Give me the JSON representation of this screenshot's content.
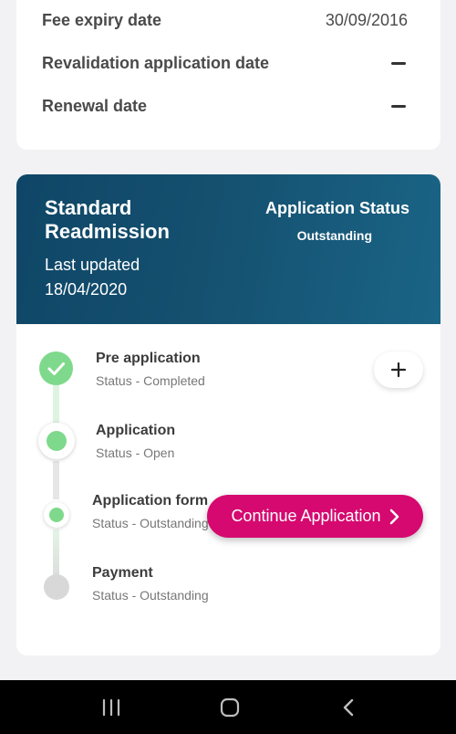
{
  "info": {
    "rows": [
      {
        "label": "Fee expiry date",
        "value": "30/09/2016"
      },
      {
        "label": "Revalidation application date",
        "value": "—"
      },
      {
        "label": "Renewal date",
        "value": "—"
      }
    ]
  },
  "readmission": {
    "title": "Standard Readmission",
    "last_updated_label": "Last updated",
    "last_updated_date": "18/04/2020",
    "status_label": "Application Status",
    "status_value": "Outstanding"
  },
  "steps": [
    {
      "title": "Pre application",
      "status": "Status - Completed"
    },
    {
      "title": "Application",
      "status": "Status - Open"
    },
    {
      "title": "Application form",
      "status": "Status - Outstanding"
    },
    {
      "title": "Payment",
      "status": "Status - Outstanding"
    }
  ],
  "actions": {
    "continue_label": "Continue Application"
  },
  "icons": {
    "check": "check-icon",
    "plus": "plus-icon",
    "chevron": "chevron-right-icon",
    "nav_recents": "recents-icon",
    "nav_home": "home-icon",
    "nav_back": "back-icon"
  },
  "colors": {
    "header_bg": "#15506f",
    "accent_green": "#7fd98c",
    "button_pink": "#d5096f"
  }
}
